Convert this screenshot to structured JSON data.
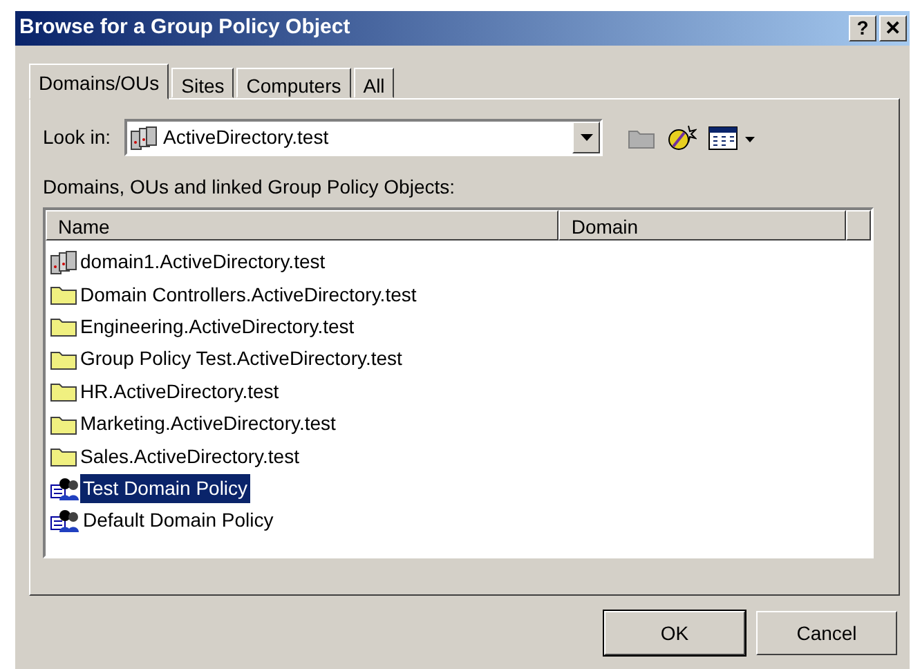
{
  "window": {
    "title": "Browse for a Group Policy Object",
    "title_buttons": [
      "?",
      "✕"
    ]
  },
  "tabs": [
    {
      "label": "Domains/OUs",
      "selected": true
    },
    {
      "label": "Sites",
      "selected": false
    },
    {
      "label": "Computers",
      "selected": false
    },
    {
      "label": "All",
      "selected": false
    }
  ],
  "look_in": {
    "label": "Look in:",
    "value": "ActiveDirectory.test"
  },
  "list_label": "Domains, OUs and linked Group Policy Objects:",
  "list": {
    "columns": [
      "Name",
      "Domain"
    ],
    "rows": [
      {
        "kind": "domain",
        "name": "domain1.ActiveDirectory.test",
        "selected": false
      },
      {
        "kind": "ou",
        "name": "Domain Controllers.ActiveDirectory.test",
        "selected": false
      },
      {
        "kind": "ou",
        "name": "Engineering.ActiveDirectory.test",
        "selected": false
      },
      {
        "kind": "ou",
        "name": "Group Policy Test.ActiveDirectory.test",
        "selected": false
      },
      {
        "kind": "ou",
        "name": "HR.ActiveDirectory.test",
        "selected": false
      },
      {
        "kind": "ou",
        "name": "Marketing.ActiveDirectory.test",
        "selected": false
      },
      {
        "kind": "ou",
        "name": "Sales.ActiveDirectory.test",
        "selected": false
      },
      {
        "kind": "gpo",
        "name": "Test Domain Policy",
        "selected": true
      },
      {
        "kind": "gpo",
        "name": "Default Domain Policy",
        "selected": false
      }
    ]
  },
  "buttons": [
    "OK",
    "Cancel"
  ]
}
